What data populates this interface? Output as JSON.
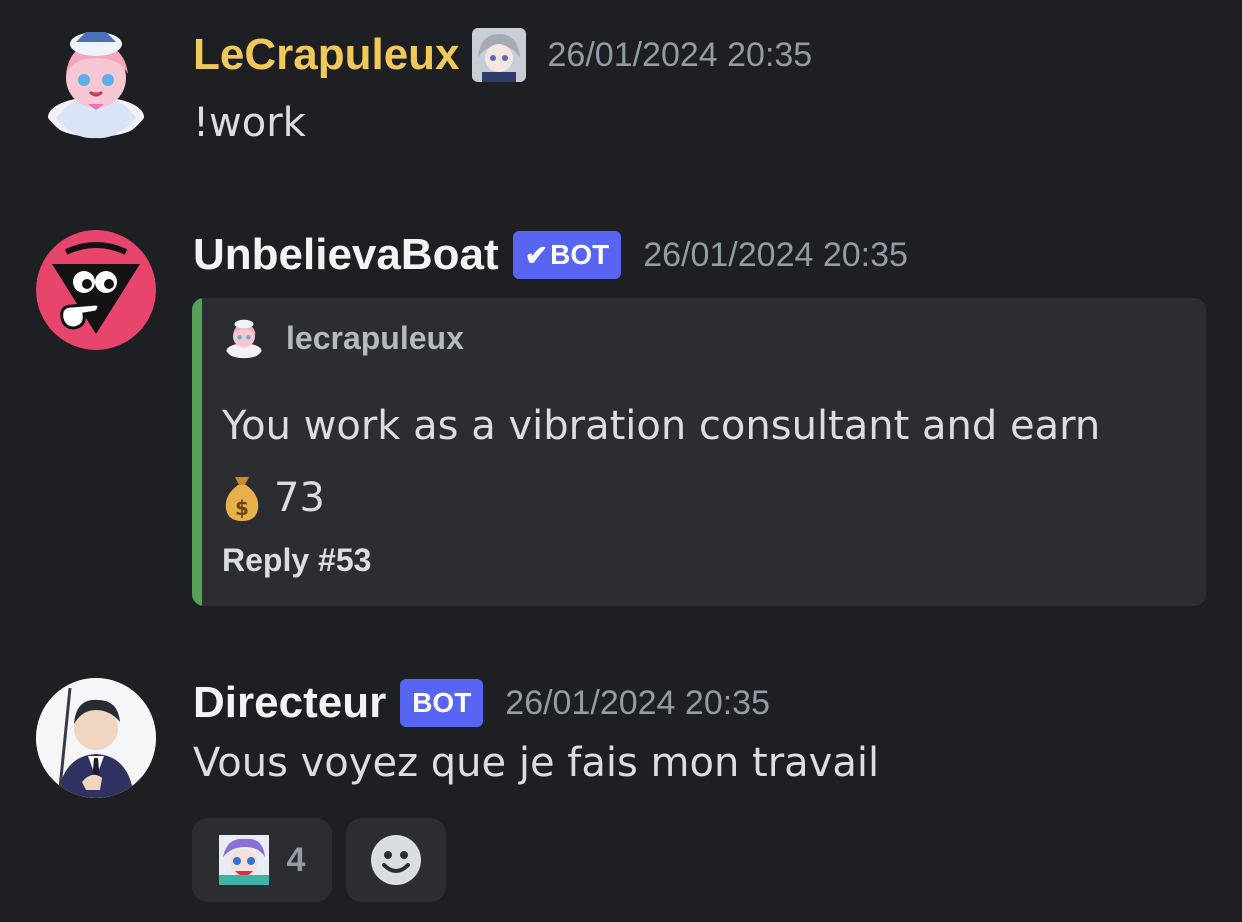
{
  "messages": [
    {
      "author": "LeCrapuleux",
      "author_color": "#f0c95a",
      "timestamp": "26/01/2024 20:35",
      "text": "!work"
    },
    {
      "author": "UnbelievaBoat",
      "author_color": "#f2f3f5",
      "bot_tag": "BOT",
      "verified": true,
      "timestamp": "26/01/2024 20:35",
      "embed": {
        "author": "lecrapuleux",
        "description_line1": "You work as a vibration consultant and earn",
        "amount": "73",
        "currency_icon": "money-bag-icon",
        "footer": "Reply #53",
        "accent_color": "#57a05a"
      }
    },
    {
      "author": "Directeur",
      "author_color": "#f2f3f5",
      "bot_tag": "BOT",
      "timestamp": "26/01/2024 20:35",
      "text": "Vous voyez que je fais mon travail",
      "reactions": [
        {
          "emoji": "custom-emoji-icon",
          "count": "4"
        }
      ],
      "add_reaction_icon": "add-reaction-icon"
    }
  ],
  "colors": {
    "background": "#1e1f22",
    "embed_background": "#2b2d31",
    "bot_tag": "#5865f2",
    "timestamp": "#949ba4"
  }
}
